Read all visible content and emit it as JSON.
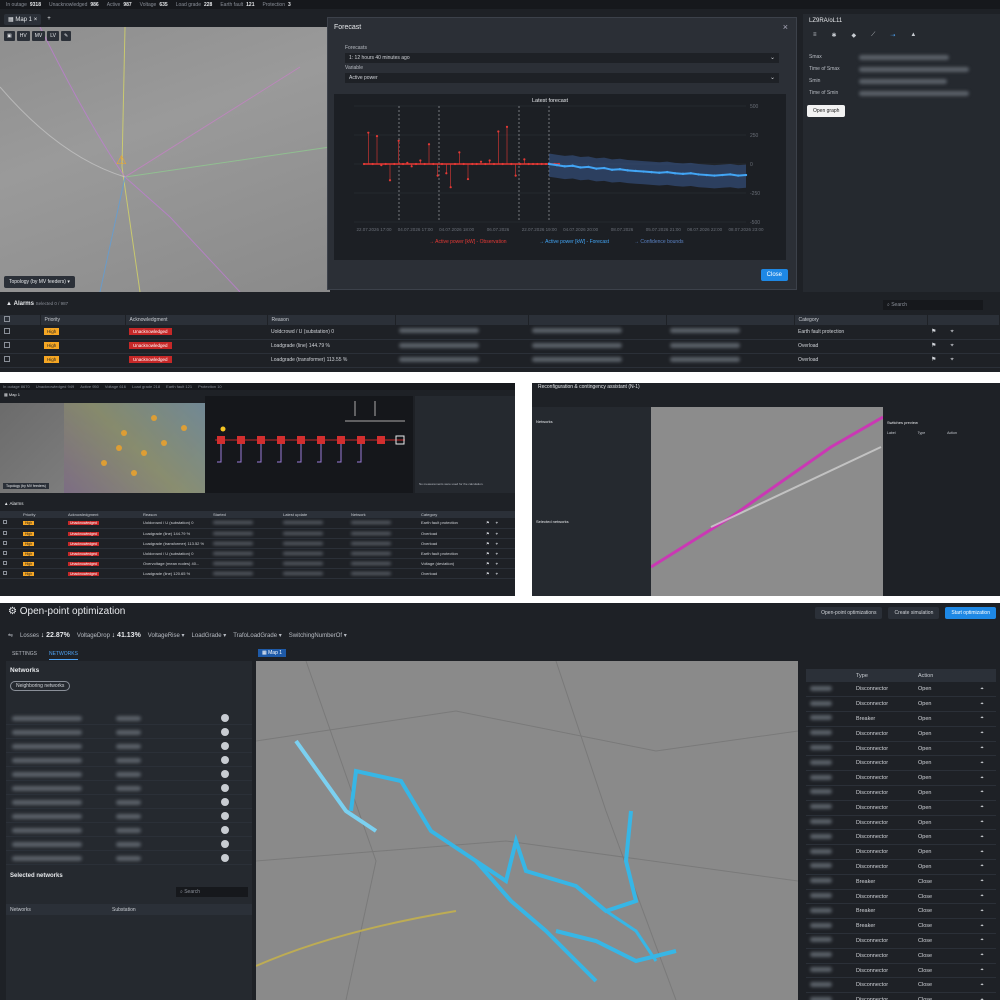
{
  "panel1": {
    "status_bar": [
      {
        "label": "In outage",
        "value": "9318"
      },
      {
        "label": "Unacknowledged",
        "value": "986"
      },
      {
        "label": "Active",
        "value": "987"
      },
      {
        "label": "Voltage",
        "value": "635"
      },
      {
        "label": "Load grade",
        "value": "228"
      },
      {
        "label": "Earth fault",
        "value": "121"
      },
      {
        "label": "Protection",
        "value": "3"
      }
    ],
    "map_tab": "Map 1",
    "map_tools": [
      "HV",
      "MV",
      "LV"
    ],
    "topology_button": "Topology (by MV feeders)",
    "forecast_modal": {
      "title": "Forecast",
      "forecasts_label": "Forecasts",
      "forecasts_value": "1: 12 hours 40 minutes ago",
      "variable_label": "Variable",
      "variable_value": "Active power",
      "close_label": "Close"
    },
    "right_panel": {
      "title": "LZ9RA/oL11",
      "rows": [
        "Smax",
        "Time of Smax",
        "Smin",
        "Time of Smin"
      ],
      "open_graph": "Open graph"
    },
    "alarms": {
      "title": "Alarms",
      "selected": "Selected 0 / 987",
      "search_placeholder": "Search",
      "columns": [
        "Priority",
        "Acknowledgment",
        "Reason",
        "",
        "",
        "",
        "Category"
      ],
      "rows": [
        {
          "priority": "High",
          "ack": "Unacknowledged",
          "reason": "Uoldcrowd / U (substation) 0",
          "category": "Earth fault protection"
        },
        {
          "priority": "High",
          "ack": "Unacknowledged",
          "reason": "Loadgrade (line) 144.79 %",
          "category": "Overload"
        },
        {
          "priority": "High",
          "ack": "Unacknowledged",
          "reason": "Loadgrade (transformer) 113.55 %",
          "category": "Overload"
        }
      ]
    }
  },
  "chart_data": {
    "type": "line",
    "title": "Latest forecast",
    "x_ticks": [
      "22.07.2026 17:00",
      "04.07.2026 17:00",
      "04.07.2026 18:00",
      "06.07.2026",
      "22.07.2026 19:00",
      "04.07.2026 20:00",
      "08.07.2026",
      "05.07.2026 21:00",
      "08.07.2026 22:00",
      "08.07.2026 23:00"
    ],
    "y_ticks": [
      500,
      250,
      0,
      -250,
      -500
    ],
    "ylim": [
      -500,
      500
    ],
    "series": [
      {
        "name": "Active power [kW] - Observation",
        "color": "#e53935",
        "values": [
          0,
          270,
          0,
          240,
          -10,
          0,
          -140,
          0,
          200,
          0,
          10,
          -20,
          0,
          30,
          0,
          170,
          0,
          -100,
          0,
          -80,
          -200,
          0,
          100,
          0,
          -130,
          0,
          0,
          20,
          0,
          30,
          0,
          280,
          0,
          320,
          0,
          -100,
          0,
          40,
          0,
          0,
          0,
          0,
          0,
          0,
          0,
          0
        ]
      },
      {
        "name": "Active power [kW] - Forecast",
        "color": "#42a5f5",
        "values": [
          0,
          -10,
          -20,
          -15,
          -30,
          -25,
          -40,
          -35,
          -50,
          -45,
          -55,
          -60,
          -65,
          -70,
          -75,
          -70,
          -80,
          -85,
          -80,
          -90,
          -95,
          -100,
          -95,
          -90,
          -100,
          -95
        ]
      }
    ],
    "legend": [
      "Active power [kW] - Observation",
      "Active power [kW] - Forecast",
      "Confidence bounds"
    ]
  },
  "panel2": {
    "status_bar": [
      "In outage 8670",
      "Unacknowledged 949",
      "Active 950",
      "Voltage 616",
      "Load grade 218",
      "Earth fault 121",
      "Protection 10"
    ],
    "map_tab": "Map 1",
    "topology_button": "Topology (by MV feeders)",
    "alarms_title": "Alarms",
    "columns": [
      "Priority",
      "Acknowledgment",
      "Reason",
      "Started",
      "Latest update",
      "Network",
      "Category"
    ],
    "rows": [
      {
        "priority": "High",
        "ack": "Unacknowledged",
        "reason": "Uoldcrowd / U (substation) 0",
        "category": "Earth fault protection"
      },
      {
        "priority": "High",
        "ack": "Unacknowledged",
        "reason": "Loadgrade (line) 144.79 %",
        "category": "Overload"
      },
      {
        "priority": "High",
        "ack": "Unacknowledged",
        "reason": "Loadgrade (transformer) 113.52 %",
        "category": "Overload"
      },
      {
        "priority": "High",
        "ack": "Unacknowledged",
        "reason": "Uoldcrowd / U (substation) 0",
        "category": "Earth fault protection"
      },
      {
        "priority": "High",
        "ack": "Unacknowledged",
        "reason": "Overvoltage (mean nodes) 40...",
        "category": "Voltage (deviation)"
      },
      {
        "priority": "High",
        "ack": "Unacknowledged",
        "reason": "Loadgrade (line) 120.65 %",
        "category": "Overload"
      }
    ],
    "note": "No measurements were used for the calculation."
  },
  "panel3": {
    "title": "Reconfiguration & contingency assistant (N-1)",
    "left_label": "Networks",
    "selected_label": "Selected networks",
    "map_tab": "Map 1",
    "right_title": "Switches preview",
    "right_cols": [
      "Label",
      "Type",
      "Action"
    ]
  },
  "panel4": {
    "title": "Open-point optimization",
    "buttons": [
      "Open-point optimizations",
      "Create simulation",
      "Start optimization"
    ],
    "metrics": [
      {
        "label": "Losses",
        "value": "↓ 22.87%"
      },
      {
        "label": "VoltageDrop",
        "value": "↓ 41.13%"
      },
      {
        "label": "VoltageRise",
        "value": ""
      },
      {
        "label": "LoadGrade",
        "value": ""
      },
      {
        "label": "TrafoLoadGrade",
        "value": ""
      },
      {
        "label": "SwitchingNumberOf",
        "value": ""
      }
    ],
    "tabs": [
      "SETTINGS",
      "NETWORKS"
    ],
    "networks_label": "Networks",
    "neighboring_button": "Neighboring networks",
    "selected_label": "Selected networks",
    "search_placeholder": "Search",
    "selected_cols": [
      "Networks",
      "Substation"
    ],
    "map_tab": "Map 1",
    "action_cols": [
      "",
      "Type",
      "Action"
    ],
    "action_rows": [
      [
        "Disconnector",
        "Open"
      ],
      [
        "Disconnector",
        "Open"
      ],
      [
        "Breaker",
        "Open"
      ],
      [
        "Disconnector",
        "Open"
      ],
      [
        "Disconnector",
        "Open"
      ],
      [
        "Disconnector",
        "Open"
      ],
      [
        "Disconnector",
        "Open"
      ],
      [
        "Disconnector",
        "Open"
      ],
      [
        "Disconnector",
        "Open"
      ],
      [
        "Disconnector",
        "Open"
      ],
      [
        "Disconnector",
        "Open"
      ],
      [
        "Disconnector",
        "Open"
      ],
      [
        "Disconnector",
        "Open"
      ],
      [
        "Breaker",
        "Close"
      ],
      [
        "Disconnector",
        "Close"
      ],
      [
        "Breaker",
        "Close"
      ],
      [
        "Breaker",
        "Close"
      ],
      [
        "Disconnector",
        "Close"
      ],
      [
        "Disconnector",
        "Close"
      ],
      [
        "Disconnector",
        "Close"
      ],
      [
        "Disconnector",
        "Close"
      ],
      [
        "Disconnector",
        "Close"
      ]
    ]
  }
}
